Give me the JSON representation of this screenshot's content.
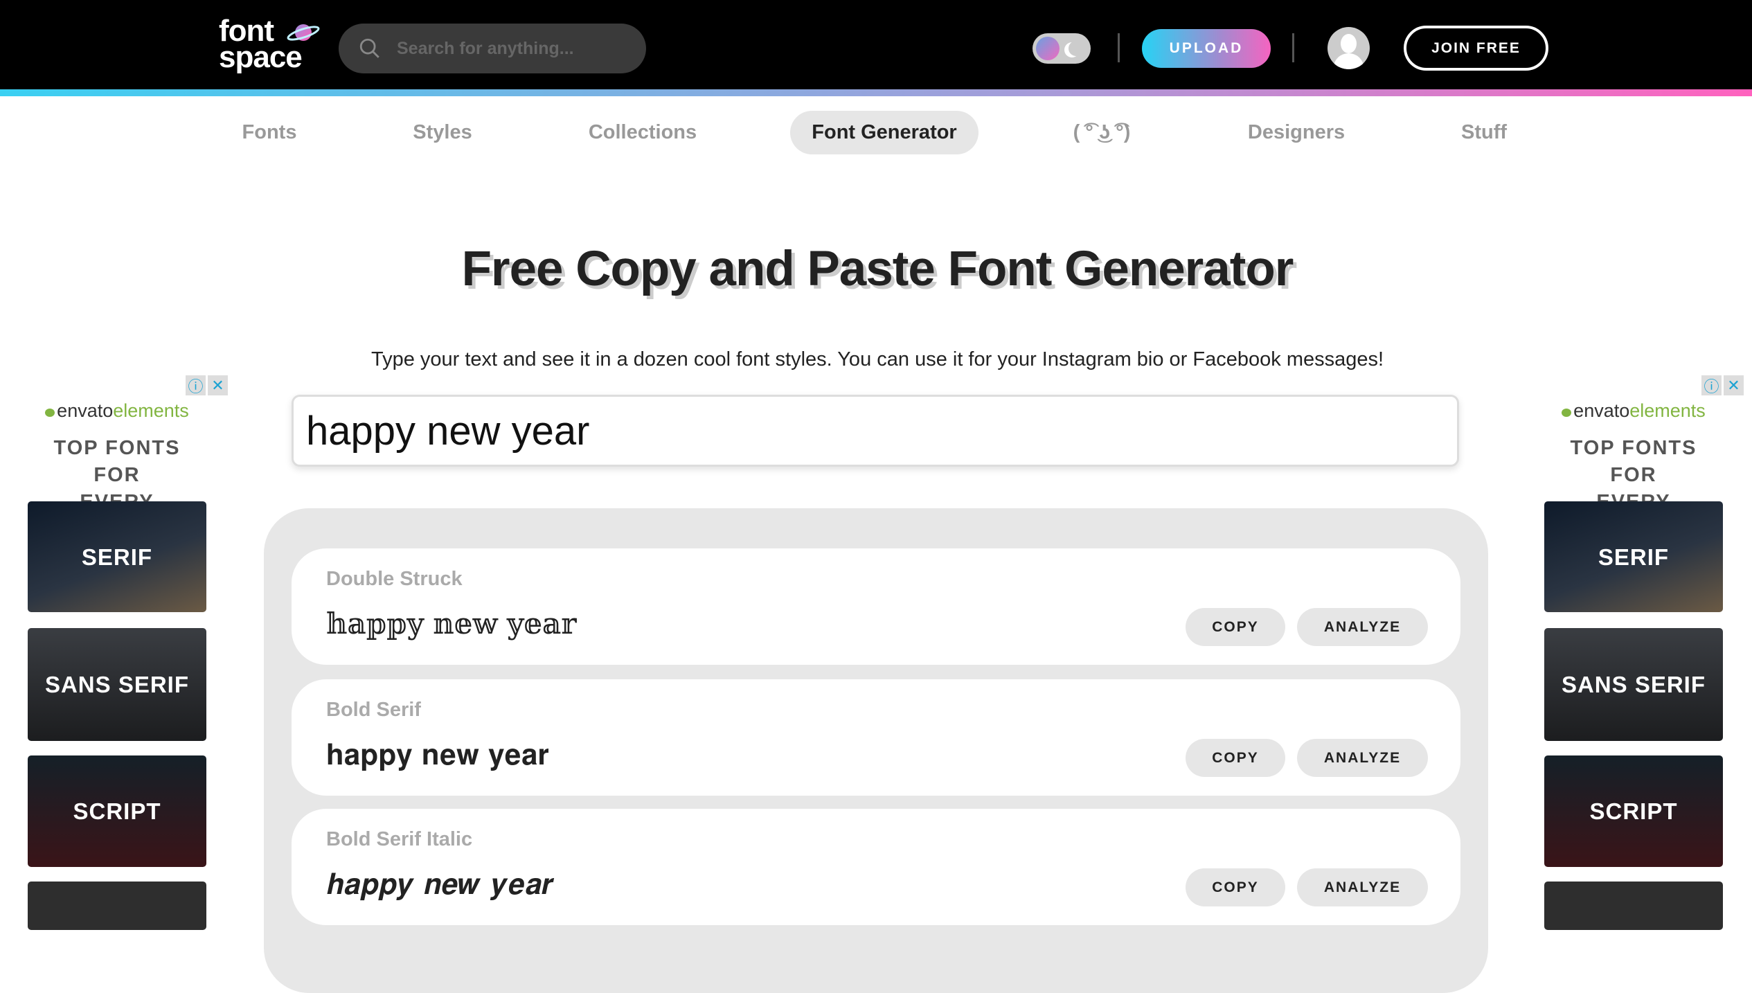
{
  "header": {
    "logo": "font space",
    "search_placeholder": "Search for anything...",
    "upload_label": "UPLOAD",
    "join_label": "JOIN FREE"
  },
  "nav": {
    "items": [
      {
        "label": "Fonts"
      },
      {
        "label": "Styles"
      },
      {
        "label": "Collections"
      },
      {
        "label": "Font Generator",
        "active": true
      },
      {
        "label": "( ͡° ͜ʖ ͡°)"
      },
      {
        "label": "Designers"
      },
      {
        "label": "Stuff"
      }
    ]
  },
  "page": {
    "title": "Free Copy and Paste Font Generator",
    "subtitle": "Type your text and see it in a dozen cool font styles. You can use it for your Instagram bio or Facebook messages!",
    "input_value": "happy new year"
  },
  "results": [
    {
      "name": "Double Struck",
      "sample": "𝕙𝕒𝕡𝕡𝕪 𝕟𝕖𝕨 𝕪𝕖𝕒𝕣",
      "copy": "COPY",
      "analyze": "ANALYZE"
    },
    {
      "name": "Bold Serif",
      "sample": "𝐡𝐚𝐩𝐩𝐲 𝐧𝐞𝐰 𝐲𝐞𝐚𝐫",
      "copy": "COPY",
      "analyze": "ANALYZE"
    },
    {
      "name": "Bold Serif Italic",
      "sample": "𝒉𝒂𝒑𝒑𝒚 𝒏𝒆𝒘 𝒚𝒆𝒂𝒓",
      "copy": "COPY",
      "analyze": "ANALYZE"
    }
  ],
  "ad": {
    "brand_a": "envato",
    "brand_b": "elements",
    "headline_1": "TOP FONTS FOR",
    "headline_2": "EVERY PROJECT",
    "tiles": [
      "SERIF",
      "SANS SERIF",
      "SCRIPT"
    ]
  },
  "colors": {
    "accent_cyan": "#27d3f4",
    "accent_pink": "#f564c0",
    "header_bg": "#000000"
  }
}
